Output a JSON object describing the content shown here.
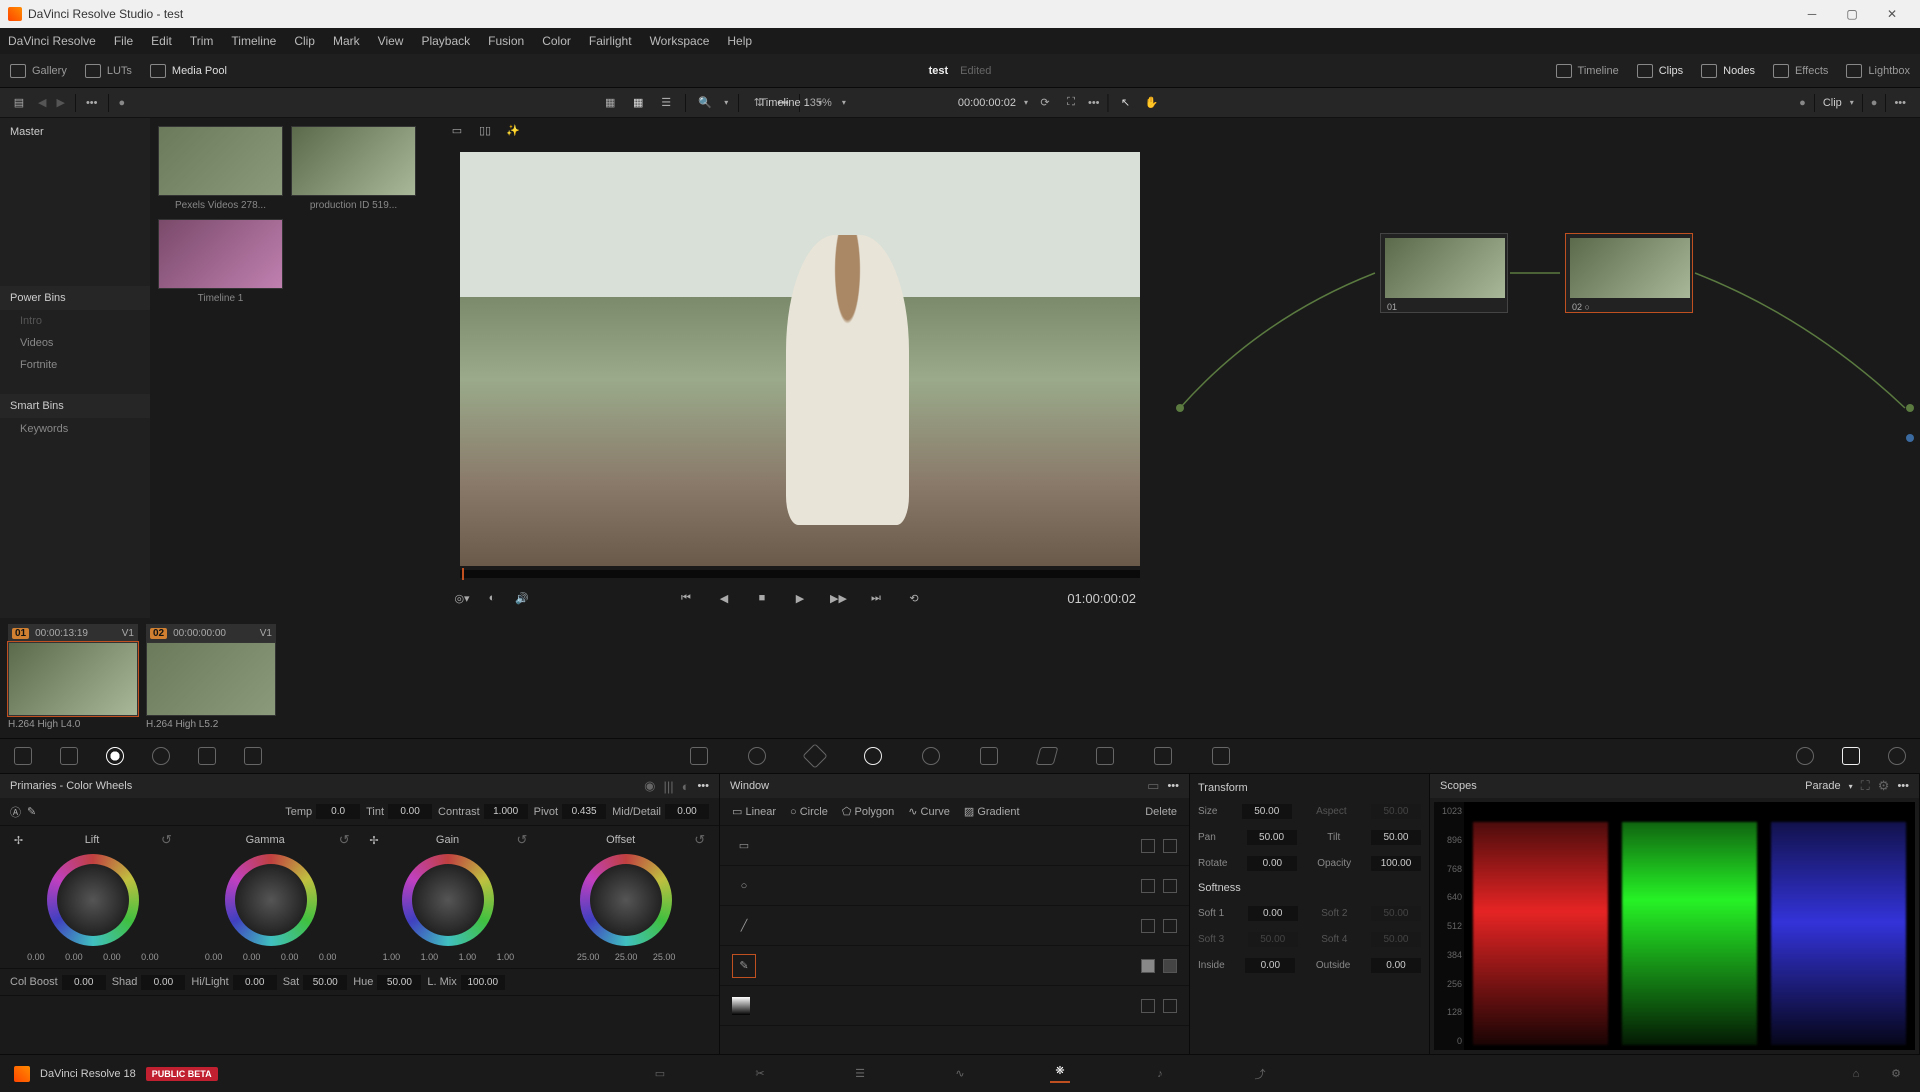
{
  "app": {
    "title": "DaVinci Resolve Studio - test",
    "doc_name": "test",
    "doc_status": "Edited"
  },
  "menu": [
    "DaVinci Resolve",
    "File",
    "Edit",
    "Trim",
    "Timeline",
    "Clip",
    "Mark",
    "View",
    "Playback",
    "Fusion",
    "Color",
    "Fairlight",
    "Workspace",
    "Help"
  ],
  "toolbar": {
    "gallery": "Gallery",
    "luts": "LUTs",
    "media_pool": "Media Pool",
    "timeline": "Timeline",
    "clips": "Clips",
    "nodes": "Nodes",
    "effects": "Effects",
    "lightbox": "Lightbox"
  },
  "subbar": {
    "zoom": "35%",
    "timeline_name": "Timeline 1",
    "timecode": "00:00:00:02",
    "clip_label": "Clip"
  },
  "bins": {
    "master": "Master",
    "power_bins_hdr": "Power Bins",
    "power_items": [
      "Intro",
      "Videos",
      "Fortnite"
    ],
    "smart_bins_hdr": "Smart Bins",
    "smart_items": [
      "Keywords"
    ]
  },
  "media": [
    {
      "name": "Pexels Videos 278..."
    },
    {
      "name": "production ID 519..."
    },
    {
      "name": "Timeline 1"
    }
  ],
  "viewer": {
    "tc": "01:00:00:02"
  },
  "nodes": [
    {
      "label": "01"
    },
    {
      "label": "02"
    }
  ],
  "clips": [
    {
      "num": "01",
      "tc": "00:00:13:19",
      "track": "V1",
      "codec": "H.264 High L4.0"
    },
    {
      "num": "02",
      "tc": "00:00:00:00",
      "track": "V1",
      "codec": "H.264 High L5.2"
    }
  ],
  "primaries": {
    "title": "Primaries - Color Wheels",
    "params": {
      "temp": {
        "label": "Temp",
        "val": "0.0"
      },
      "tint": {
        "label": "Tint",
        "val": "0.00"
      },
      "contrast": {
        "label": "Contrast",
        "val": "1.000"
      },
      "pivot": {
        "label": "Pivot",
        "val": "0.435"
      },
      "mid": {
        "label": "Mid/Detail",
        "val": "0.00"
      }
    },
    "wheels": {
      "lift": {
        "label": "Lift",
        "vals": [
          "0.00",
          "0.00",
          "0.00",
          "0.00"
        ]
      },
      "gamma": {
        "label": "Gamma",
        "vals": [
          "0.00",
          "0.00",
          "0.00",
          "0.00"
        ]
      },
      "gain": {
        "label": "Gain",
        "vals": [
          "1.00",
          "1.00",
          "1.00",
          "1.00"
        ]
      },
      "offset": {
        "label": "Offset",
        "vals": [
          "25.00",
          "25.00",
          "25.00"
        ]
      }
    },
    "bottom": {
      "colboost": {
        "label": "Col Boost",
        "val": "0.00"
      },
      "shad": {
        "label": "Shad",
        "val": "0.00"
      },
      "hilight": {
        "label": "Hi/Light",
        "val": "0.00"
      },
      "sat": {
        "label": "Sat",
        "val": "50.00"
      },
      "hue": {
        "label": "Hue",
        "val": "50.00"
      },
      "lmix": {
        "label": "L. Mix",
        "val": "100.00"
      }
    }
  },
  "window": {
    "title": "Window",
    "tools": {
      "linear": "Linear",
      "circle": "Circle",
      "polygon": "Polygon",
      "curve": "Curve",
      "gradient": "Gradient",
      "delete": "Delete"
    }
  },
  "transform": {
    "title": "Transform",
    "size": {
      "label": "Size",
      "val": "50.00"
    },
    "aspect": {
      "label": "Aspect",
      "val": "50.00"
    },
    "pan": {
      "label": "Pan",
      "val": "50.00"
    },
    "tilt": {
      "label": "Tilt",
      "val": "50.00"
    },
    "rotate": {
      "label": "Rotate",
      "val": "0.00"
    },
    "opacity": {
      "label": "Opacity",
      "val": "100.00"
    },
    "softness_hdr": "Softness",
    "soft1": {
      "label": "Soft 1",
      "val": "0.00"
    },
    "soft2": {
      "label": "Soft 2",
      "val": "50.00"
    },
    "soft3": {
      "label": "Soft 3",
      "val": "50.00"
    },
    "soft4": {
      "label": "Soft 4",
      "val": "50.00"
    },
    "inside": {
      "label": "Inside",
      "val": "0.00"
    },
    "outside": {
      "label": "Outside",
      "val": "0.00"
    }
  },
  "scopes": {
    "title": "Scopes",
    "mode": "Parade",
    "ticks": [
      "1023",
      "896",
      "768",
      "640",
      "512",
      "384",
      "256",
      "128",
      "0"
    ]
  },
  "footer": {
    "product": "DaVinci Resolve 18",
    "badge": "PUBLIC BETA"
  }
}
